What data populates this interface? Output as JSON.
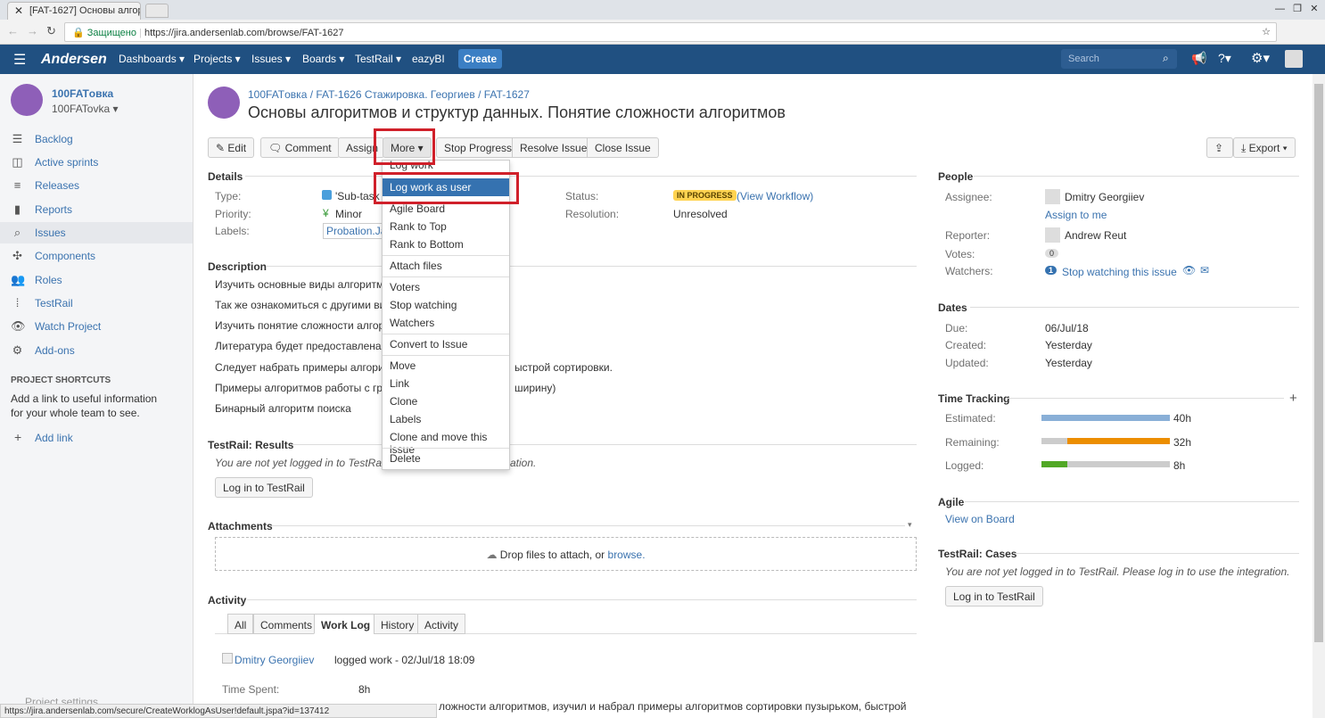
{
  "browser": {
    "tab_title": "[FAT-1627] Основы алгор",
    "secure_label": "Защищено",
    "url": "https://jira.andersenlab.com/browse/FAT-1627"
  },
  "nav": {
    "logo": "Andersen",
    "items": [
      "Dashboards ▾",
      "Projects ▾",
      "Issues ▾",
      "Boards ▾",
      "TestRail ▾",
      "eazyBI"
    ],
    "create": "Create",
    "search_placeholder": "Search"
  },
  "sidebar": {
    "project_name": "100FATовка",
    "project_key": "100FATovka ▾",
    "items": [
      {
        "label": "Backlog",
        "icon": "backlog-icon"
      },
      {
        "label": "Active sprints",
        "icon": "sprint-icon"
      },
      {
        "label": "Releases",
        "icon": "releases-icon"
      },
      {
        "label": "Reports",
        "icon": "reports-icon"
      },
      {
        "label": "Issues",
        "icon": "issues-icon"
      },
      {
        "label": "Components",
        "icon": "components-icon"
      },
      {
        "label": "Roles",
        "icon": "roles-icon"
      },
      {
        "label": "TestRail",
        "icon": "testrail-icon"
      },
      {
        "label": "Watch Project",
        "icon": "eye-icon"
      },
      {
        "label": "Add-ons",
        "icon": "addons-icon"
      }
    ],
    "shortcuts_title": "PROJECT SHORTCUTS",
    "shortcuts_text": "Add a link to useful information for your whole team to see.",
    "add_link": "Add link",
    "settings": "Project settings"
  },
  "issue": {
    "breadcrumb": [
      "100FATовка",
      "FAT-1626 Стажировка. Георгиев",
      "FAT-1627"
    ],
    "title": "Основы алгоритмов и структур данных. Понятие сложности алгоритмов"
  },
  "toolbar": {
    "edit": "Edit",
    "comment": "Comment",
    "assign": "Assign",
    "more": "More ▾",
    "stop_progress": "Stop Progress",
    "resolve": "Resolve Issue",
    "close": "Close Issue",
    "export": "Export ▾"
  },
  "menu": {
    "items": [
      "Log work",
      "Log work as user",
      "Agile Board",
      "Rank to Top",
      "Rank to Bottom",
      "Attach files",
      "Voters",
      "Stop watching",
      "Watchers",
      "Convert to Issue",
      "Move",
      "Link",
      "Clone",
      "Labels",
      "Clone and move this issue",
      "Delete"
    ],
    "highlighted": "Log work as user",
    "highlight_color": "#3572b0",
    "annotation_color": "#d0202a"
  },
  "details": {
    "title": "Details",
    "type_label": "Type:",
    "type_value": "'Sub-task",
    "priority_label": "Priority:",
    "priority_value": "Minor",
    "labels_label": "Labels:",
    "labels_value": "Probation.Jav",
    "status_label": "Status:",
    "status_value": "IN PROGRESS",
    "view_workflow": "(View Workflow)",
    "resolution_label": "Resolution:",
    "resolution_value": "Unresolved"
  },
  "description": {
    "title": "Description",
    "lines": [
      "Изучить основные виды алгоритмов с",
      "Так же ознакомиться с другими видам",
      "Изучить понятие сложности алгоритм",
      "Литература будет предоставлена.",
      "Следует набрать примеры алгоритма",
      "Примеры алгоритмов работы с графо",
      "Бинарный алгоритм поиска"
    ],
    "line5_tail": "ыстрой сортировки.",
    "line6_tail": "ширину)"
  },
  "testrail": {
    "title": "TestRail: Results",
    "text": "You are not yet logged in to TestRail. P",
    "text_tail": "ation.",
    "button": "Log in to TestRail"
  },
  "attachments": {
    "title": "Attachments",
    "drop": "Drop files to attach, or",
    "browse": "browse."
  },
  "activity": {
    "title": "Activity",
    "tabs": [
      "All",
      "Comments",
      "Work Log",
      "History",
      "Activity"
    ],
    "active_tab": "Work Log",
    "author": "Dmitry Georgiiev",
    "entry": "logged work - 02/Jul/18 18:09",
    "time_spent_label": "Time Spent:",
    "time_spent": "8h",
    "comment_line": "ложности алгоритмов, изучил и набрал примеры алгоритмов сортировки пузырьком, быстрой"
  },
  "people": {
    "title": "People",
    "assignee_label": "Assignee:",
    "assignee": "Dmitry Georgiiev",
    "assign_to_me": "Assign to me",
    "reporter_label": "Reporter:",
    "reporter": "Andrew Reut",
    "votes_label": "Votes:",
    "votes": "0",
    "watchers_label": "Watchers:",
    "watchers_count": "1",
    "stop_watching": "Stop watching this issue"
  },
  "dates": {
    "title": "Dates",
    "due_label": "Due:",
    "due": "06/Jul/18",
    "created_label": "Created:",
    "created": "Yesterday",
    "updated_label": "Updated:",
    "updated": "Yesterday"
  },
  "time_tracking": {
    "title": "Time Tracking",
    "estimated_label": "Estimated:",
    "estimated": "40h",
    "remaining_label": "Remaining:",
    "remaining": "32h",
    "logged_label": "Logged:",
    "logged": "8h",
    "estimated_fraction": 1.0,
    "remaining_fraction": 0.8,
    "logged_fraction": 0.2,
    "colors": {
      "estimated": "#89afd7",
      "remaining": "#ec8e00",
      "logged": "#51a825",
      "empty": "#ccc"
    }
  },
  "agile": {
    "title": "Agile",
    "view_on_board": "View on Board"
  },
  "testrail_cases": {
    "title": "TestRail: Cases",
    "text": "You are not yet logged in to TestRail. Please log in to use the integration.",
    "button": "Log in to TestRail"
  },
  "statusbar": "https://jira.andersenlab.com/secure/CreateWorklogAsUser!default.jspa?id=137412"
}
